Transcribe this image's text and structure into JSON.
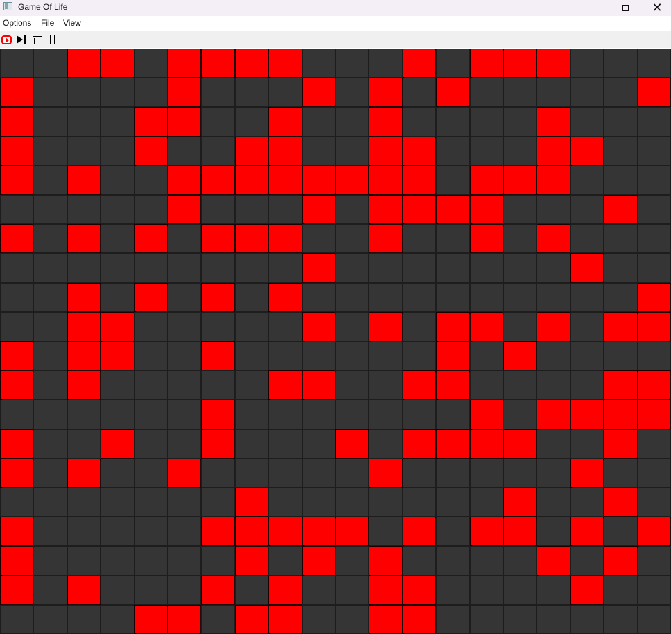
{
  "window": {
    "title": "Game Of Life",
    "controls": {
      "minimize_icon": "minimize-icon",
      "maximize_icon": "maximize-icon",
      "close_icon": "close-icon",
      "close_glyph": "✕"
    }
  },
  "menu": {
    "items": [
      {
        "label": "Options"
      },
      {
        "label": "File"
      },
      {
        "label": "View"
      }
    ]
  },
  "toolbar": {
    "tools": [
      {
        "icon": "play-icon"
      },
      {
        "icon": "step-forward-icon"
      },
      {
        "icon": "trash-icon"
      },
      {
        "icon": "pause-icon"
      }
    ]
  },
  "colors": {
    "alive": "#ff0000",
    "dead": "#353535",
    "gridline": "#1d1d1d",
    "toolbar": "#f0f0f0",
    "titlebar": "#f4eff6"
  },
  "board": {
    "rows": 20,
    "columns": 20,
    "cells": [
      [
        0,
        0,
        1,
        1,
        0,
        1,
        1,
        1,
        1,
        0,
        0,
        0,
        1,
        0,
        1,
        1,
        1,
        0,
        0,
        0
      ],
      [
        1,
        0,
        0,
        0,
        0,
        1,
        0,
        0,
        0,
        1,
        0,
        1,
        0,
        1,
        0,
        0,
        0,
        0,
        0,
        1
      ],
      [
        1,
        0,
        0,
        0,
        1,
        1,
        0,
        0,
        1,
        0,
        0,
        1,
        0,
        0,
        0,
        0,
        1,
        0,
        0,
        0
      ],
      [
        1,
        0,
        0,
        0,
        1,
        0,
        0,
        1,
        1,
        0,
        0,
        1,
        1,
        0,
        0,
        0,
        1,
        1,
        0,
        0
      ],
      [
        1,
        0,
        1,
        0,
        0,
        1,
        1,
        1,
        1,
        1,
        1,
        1,
        1,
        0,
        1,
        1,
        1,
        0,
        0,
        0
      ],
      [
        0,
        0,
        0,
        0,
        0,
        1,
        0,
        0,
        0,
        1,
        0,
        1,
        1,
        1,
        1,
        0,
        0,
        0,
        1,
        0
      ],
      [
        1,
        0,
        1,
        0,
        1,
        0,
        1,
        1,
        1,
        0,
        0,
        1,
        0,
        0,
        1,
        0,
        1,
        0,
        0,
        0
      ],
      [
        0,
        0,
        0,
        0,
        0,
        0,
        0,
        0,
        0,
        1,
        0,
        0,
        0,
        0,
        0,
        0,
        0,
        1,
        0,
        0
      ],
      [
        0,
        0,
        1,
        0,
        1,
        0,
        1,
        0,
        1,
        0,
        0,
        0,
        0,
        0,
        0,
        0,
        0,
        0,
        0,
        1
      ],
      [
        0,
        0,
        1,
        1,
        0,
        0,
        0,
        0,
        0,
        1,
        0,
        1,
        0,
        1,
        1,
        0,
        1,
        0,
        1,
        1
      ],
      [
        1,
        0,
        1,
        1,
        0,
        0,
        1,
        0,
        0,
        0,
        0,
        0,
        0,
        1,
        0,
        1,
        0,
        0,
        0,
        0
      ],
      [
        1,
        0,
        1,
        0,
        0,
        0,
        0,
        0,
        1,
        1,
        0,
        0,
        1,
        1,
        0,
        0,
        0,
        0,
        1,
        1
      ],
      [
        0,
        0,
        0,
        0,
        0,
        0,
        1,
        0,
        0,
        0,
        0,
        0,
        0,
        0,
        1,
        0,
        1,
        1,
        1,
        1
      ],
      [
        1,
        0,
        0,
        1,
        0,
        0,
        1,
        0,
        0,
        0,
        1,
        0,
        1,
        1,
        1,
        1,
        0,
        0,
        1,
        0
      ],
      [
        1,
        0,
        1,
        0,
        0,
        1,
        0,
        0,
        0,
        0,
        0,
        1,
        0,
        0,
        0,
        0,
        0,
        1,
        0,
        0
      ],
      [
        0,
        0,
        0,
        0,
        0,
        0,
        0,
        1,
        0,
        0,
        0,
        0,
        0,
        0,
        0,
        1,
        0,
        0,
        1,
        0
      ],
      [
        1,
        0,
        0,
        0,
        0,
        0,
        1,
        1,
        1,
        1,
        1,
        0,
        1,
        0,
        1,
        1,
        0,
        1,
        0,
        1
      ],
      [
        1,
        0,
        0,
        0,
        0,
        0,
        0,
        1,
        0,
        1,
        0,
        1,
        0,
        0,
        0,
        0,
        1,
        0,
        1,
        0
      ],
      [
        1,
        0,
        1,
        0,
        0,
        0,
        1,
        0,
        1,
        0,
        0,
        1,
        1,
        0,
        0,
        0,
        0,
        1,
        0,
        0
      ],
      [
        0,
        0,
        0,
        0,
        1,
        1,
        0,
        1,
        1,
        0,
        0,
        1,
        1,
        0,
        0,
        0,
        0,
        0,
        0,
        0
      ]
    ]
  }
}
